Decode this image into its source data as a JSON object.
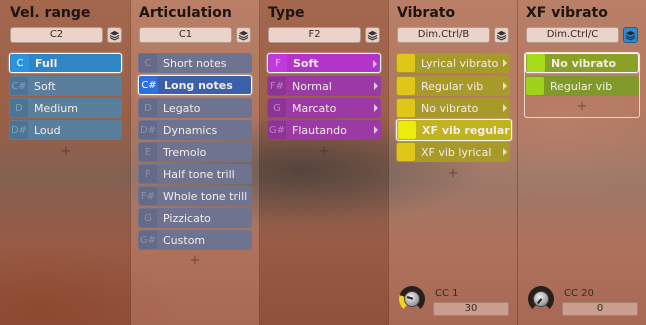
{
  "columns": {
    "vel_range": {
      "title": "Vel. range",
      "selector": "C2",
      "items": [
        {
          "key": "C",
          "label": "Full",
          "active": true
        },
        {
          "key": "C#",
          "label": "Soft"
        },
        {
          "key": "D",
          "label": "Medium"
        },
        {
          "key": "D#",
          "label": "Loud"
        }
      ],
      "add": "+"
    },
    "articulation": {
      "title": "Articulation",
      "selector": "C1",
      "items": [
        {
          "key": "C",
          "label": "Short notes"
        },
        {
          "key": "C#",
          "label": "Long notes",
          "active": true
        },
        {
          "key": "D",
          "label": "Legato"
        },
        {
          "key": "D#",
          "label": "Dynamics"
        },
        {
          "key": "E",
          "label": "Tremolo"
        },
        {
          "key": "F",
          "label": "Half tone trill"
        },
        {
          "key": "F#",
          "label": "Whole tone trill"
        },
        {
          "key": "G",
          "label": "Pizzicato"
        },
        {
          "key": "G#",
          "label": "Custom"
        }
      ],
      "add": "+"
    },
    "type": {
      "title": "Type",
      "selector": "F2",
      "items": [
        {
          "key": "F",
          "label": "Soft",
          "active": true
        },
        {
          "key": "F#",
          "label": "Normal"
        },
        {
          "key": "G",
          "label": "Marcato"
        },
        {
          "key": "G#",
          "label": "Flautando"
        }
      ],
      "add": "+"
    },
    "vibrato": {
      "title": "Vibrato",
      "selector": "Dim.Ctrl/B",
      "items": [
        {
          "label": "Lyrical vibrato"
        },
        {
          "label": "Regular vib"
        },
        {
          "label": "No vibrato"
        },
        {
          "label": "XF vib regular",
          "active": true
        },
        {
          "label": "XF vib lyrical"
        }
      ],
      "add": "+",
      "cc_label": "CC 1",
      "cc_value": "30",
      "knob_level": 0.24
    },
    "xf_vibrato": {
      "title": "XF vibrato",
      "selector": "Dim.Ctrl/C",
      "items": [
        {
          "label": "No vibrato",
          "active": true
        },
        {
          "label": "Regular vib"
        }
      ],
      "add": "+",
      "cc_label": "CC 20",
      "cc_value": "0",
      "knob_level": 0
    }
  },
  "colors": {
    "blue_item": "#5a7f9c",
    "blue_active": "#2f86c7",
    "slate_item": "#6e7490",
    "slate_active": "#3260b8",
    "purple_item": "#9b3aa4",
    "purple_active": "#b234c8",
    "olive_item": "#a89a2a",
    "olive_key": "#e0c619",
    "yellow_active": "#d8d21a",
    "green_item": "#7f9a2a",
    "green_key": "#9fd21c",
    "green_active": "#9fd21c"
  }
}
